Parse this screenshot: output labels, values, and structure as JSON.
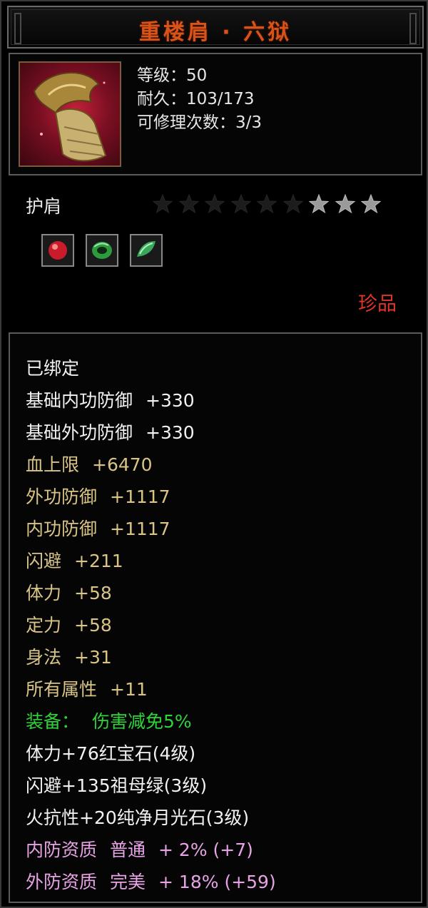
{
  "title": "重楼肩 · 六狱",
  "item_icon": "golden-pauldron-icon",
  "stats": {
    "level_label": "等级：",
    "level_value": "50",
    "durability_label": "耐久：",
    "durability_value": "103/173",
    "repair_label": "可修理次数：",
    "repair_value": "3/3"
  },
  "item_type": "护肩",
  "stars": {
    "filled": 3,
    "total": 9
  },
  "gems": [
    {
      "name": "ruby-gem-icon",
      "color": "#c81c2a"
    },
    {
      "name": "emerald-gem-icon",
      "color": "#2e9a3e"
    },
    {
      "name": "moonstone-gem-icon",
      "color": "#3aa85a"
    }
  ],
  "quality": "珍品",
  "attributes": {
    "bound": "已绑定",
    "base_inner_def": {
      "label": "基础内功防御",
      "value": "+330"
    },
    "base_outer_def": {
      "label": "基础外功防御",
      "value": "+330"
    },
    "hp_max": {
      "label": "血上限",
      "value": "+6470"
    },
    "outer_def": {
      "label": "外功防御",
      "value": "+1117"
    },
    "inner_def": {
      "label": "内功防御",
      "value": "+1117"
    },
    "dodge": {
      "label": "闪避",
      "value": "+211"
    },
    "stamina": {
      "label": "体力",
      "value": "+58"
    },
    "focus": {
      "label": "定力",
      "value": "+58"
    },
    "agility": {
      "label": "身法",
      "value": "+31"
    },
    "all_attr": {
      "label": "所有属性",
      "value": "+11"
    },
    "equip_effect": {
      "label": "装备：",
      "value": "伤害减免5%"
    },
    "gem_line_1": "体力+76红宝石(4级)",
    "gem_line_2": "闪避+135祖母绿(3级)",
    "gem_line_3": "火抗性+20纯净月光石(3级)",
    "aptitude_inner": {
      "label": "内防资质",
      "grade": "普通",
      "value": "+ 2% (+7)"
    },
    "aptitude_outer": {
      "label": "外防资质",
      "grade": "完美",
      "value": "+ 18% (+59)"
    }
  },
  "colors": {
    "title": "#d8531a",
    "base": "#f2f2f2",
    "bonus": "#d9c486",
    "equip": "#2fd33a",
    "aptitude": "#e8a2e6",
    "quality": "#e0342a"
  }
}
